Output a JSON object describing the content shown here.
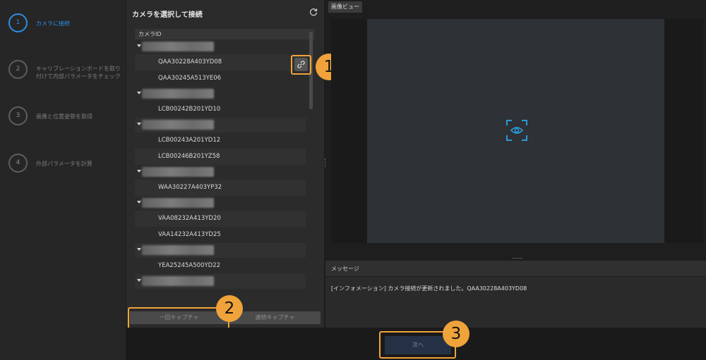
{
  "stepper": {
    "steps": [
      {
        "num": "1",
        "label": "カメラに接続"
      },
      {
        "num": "2",
        "label": "キャリブレーションボードを取り付けて内部パラメータをチェック"
      },
      {
        "num": "3",
        "label": "画像と位置姿勢を取得"
      },
      {
        "num": "4",
        "label": "外部パラメータを計算"
      }
    ]
  },
  "camera_panel": {
    "title": "カメラを選択して接続",
    "refresh_icon": "refresh-icon",
    "list_header": "カメラID",
    "items": [
      "QAA30228A403YD08",
      "QAA30245A513YE06",
      "LCB00242B201YD10",
      "LCB00243A201YD12",
      "LCB00246B201YZ58",
      "WAA30227A403YP32",
      "VAA08232A413YD20",
      "VAA14232A413YD25",
      "YEA25245A500YD22"
    ],
    "connect_icon": "link-icon",
    "single_capture": "一回キャプチャ",
    "continuous_capture": "連続キャプチャ"
  },
  "image_view": {
    "tab": "画像ビュー",
    "icon": "eye-scan-icon"
  },
  "messages": {
    "title": "メッセージ",
    "text": "[インフォメーション] カメラ接続が更新されました。QAA30228A403YD08"
  },
  "footer": {
    "next": "次へ"
  },
  "annotations": [
    "1",
    "2",
    "3"
  ],
  "colors": {
    "accent": "#2d8ee6",
    "annotation": "#f0a33a"
  }
}
